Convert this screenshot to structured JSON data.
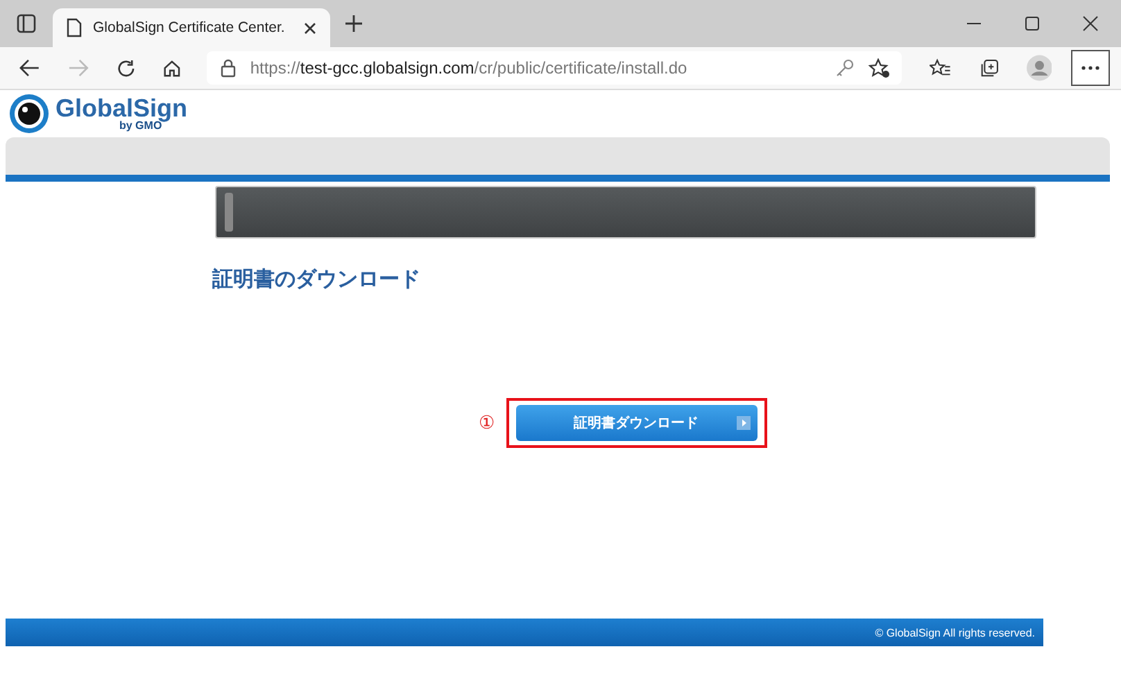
{
  "browser": {
    "tab": {
      "title": "GlobalSign Certificate Center.",
      "selected": true
    },
    "url": {
      "scheme": "https://",
      "host": "test-gcc.globalsign.com",
      "path": "/cr/public/certificate/install.do"
    }
  },
  "logo": {
    "name": "GlobalSign",
    "byline": "by GMO"
  },
  "heading": "証明書のダウンロード",
  "download_button": {
    "label": "証明書ダウンロード",
    "highlighted": true,
    "marker": "①"
  },
  "footer": {
    "copyright": "© GlobalSign All rights reserved."
  }
}
